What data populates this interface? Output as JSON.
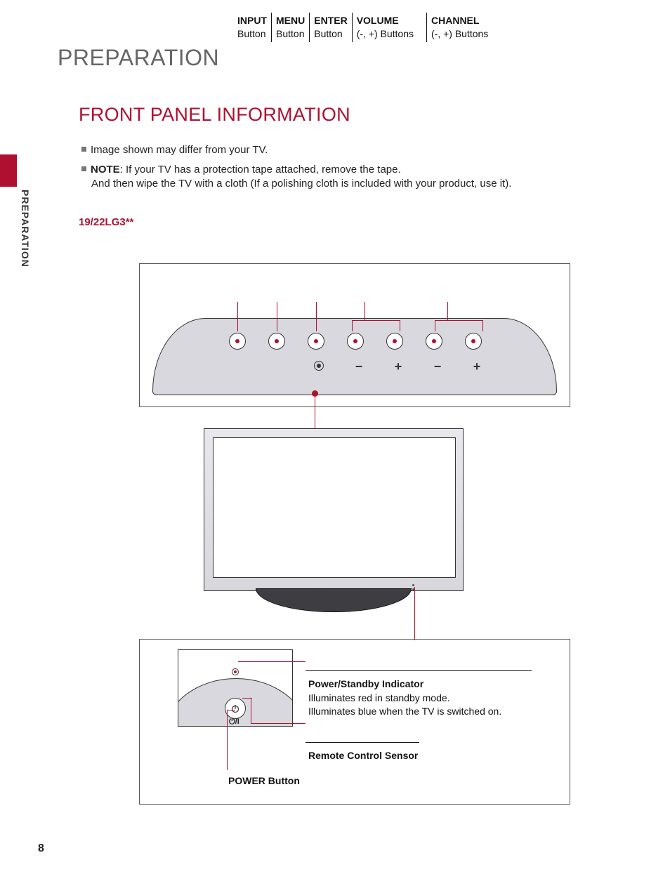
{
  "page": {
    "title": "PREPARATION",
    "section_title": "FRONT PANEL INFORMATION",
    "side_label": "PREPARATION",
    "page_number": "8"
  },
  "bullets": {
    "b1": "Image shown may differ from your TV.",
    "b2_label": "NOTE",
    "b2_text": ": If your TV has a protection tape attached, remove the tape.",
    "b2_sub": "And then wipe the TV with a cloth (If a polishing cloth is included with your product, use it)."
  },
  "model": "19/22LG3**",
  "top_labels": {
    "input_t": "INPUT",
    "input_b": "Button",
    "menu_t": "MENU",
    "menu_b": "Button",
    "enter_t": "ENTER",
    "enter_b": "Button",
    "vol_t": "VOLUME",
    "vol_b": "(-, +) Buttons",
    "ch_t": "CHANNEL",
    "ch_b": "(-, +) Buttons"
  },
  "symbols": {
    "minus1": "−",
    "plus1": "+",
    "minus2": "−",
    "plus2": "+"
  },
  "bottom_labels": {
    "power_symbol": "⏻/I",
    "indicator_t": "Power/Standby Indicator",
    "indicator_l1": "Illuminates red in standby mode.",
    "indicator_l2": "Illuminates blue when the TV is switched on.",
    "sensor_t": "Remote Control Sensor",
    "power_t": "POWER Button"
  }
}
